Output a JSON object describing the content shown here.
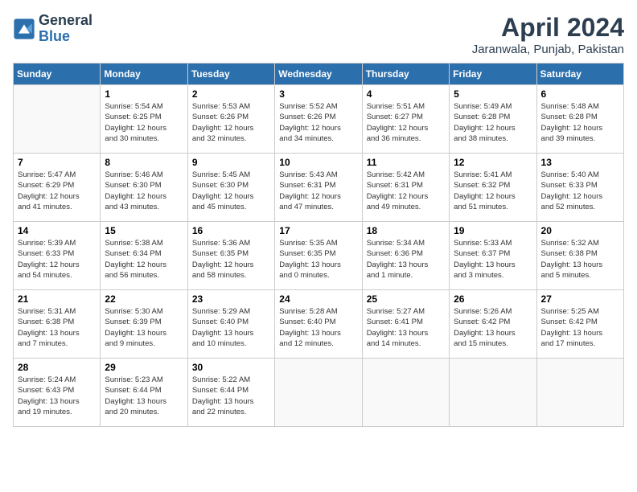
{
  "header": {
    "logo_line1": "General",
    "logo_line2": "Blue",
    "title": "April 2024",
    "subtitle": "Jaranwala, Punjab, Pakistan"
  },
  "calendar": {
    "days_of_week": [
      "Sunday",
      "Monday",
      "Tuesday",
      "Wednesday",
      "Thursday",
      "Friday",
      "Saturday"
    ],
    "weeks": [
      [
        {
          "day": "",
          "info": ""
        },
        {
          "day": "1",
          "info": "Sunrise: 5:54 AM\nSunset: 6:25 PM\nDaylight: 12 hours\nand 30 minutes."
        },
        {
          "day": "2",
          "info": "Sunrise: 5:53 AM\nSunset: 6:26 PM\nDaylight: 12 hours\nand 32 minutes."
        },
        {
          "day": "3",
          "info": "Sunrise: 5:52 AM\nSunset: 6:26 PM\nDaylight: 12 hours\nand 34 minutes."
        },
        {
          "day": "4",
          "info": "Sunrise: 5:51 AM\nSunset: 6:27 PM\nDaylight: 12 hours\nand 36 minutes."
        },
        {
          "day": "5",
          "info": "Sunrise: 5:49 AM\nSunset: 6:28 PM\nDaylight: 12 hours\nand 38 minutes."
        },
        {
          "day": "6",
          "info": "Sunrise: 5:48 AM\nSunset: 6:28 PM\nDaylight: 12 hours\nand 39 minutes."
        }
      ],
      [
        {
          "day": "7",
          "info": "Sunrise: 5:47 AM\nSunset: 6:29 PM\nDaylight: 12 hours\nand 41 minutes."
        },
        {
          "day": "8",
          "info": "Sunrise: 5:46 AM\nSunset: 6:30 PM\nDaylight: 12 hours\nand 43 minutes."
        },
        {
          "day": "9",
          "info": "Sunrise: 5:45 AM\nSunset: 6:30 PM\nDaylight: 12 hours\nand 45 minutes."
        },
        {
          "day": "10",
          "info": "Sunrise: 5:43 AM\nSunset: 6:31 PM\nDaylight: 12 hours\nand 47 minutes."
        },
        {
          "day": "11",
          "info": "Sunrise: 5:42 AM\nSunset: 6:31 PM\nDaylight: 12 hours\nand 49 minutes."
        },
        {
          "day": "12",
          "info": "Sunrise: 5:41 AM\nSunset: 6:32 PM\nDaylight: 12 hours\nand 51 minutes."
        },
        {
          "day": "13",
          "info": "Sunrise: 5:40 AM\nSunset: 6:33 PM\nDaylight: 12 hours\nand 52 minutes."
        }
      ],
      [
        {
          "day": "14",
          "info": "Sunrise: 5:39 AM\nSunset: 6:33 PM\nDaylight: 12 hours\nand 54 minutes."
        },
        {
          "day": "15",
          "info": "Sunrise: 5:38 AM\nSunset: 6:34 PM\nDaylight: 12 hours\nand 56 minutes."
        },
        {
          "day": "16",
          "info": "Sunrise: 5:36 AM\nSunset: 6:35 PM\nDaylight: 12 hours\nand 58 minutes."
        },
        {
          "day": "17",
          "info": "Sunrise: 5:35 AM\nSunset: 6:35 PM\nDaylight: 13 hours\nand 0 minutes."
        },
        {
          "day": "18",
          "info": "Sunrise: 5:34 AM\nSunset: 6:36 PM\nDaylight: 13 hours\nand 1 minute."
        },
        {
          "day": "19",
          "info": "Sunrise: 5:33 AM\nSunset: 6:37 PM\nDaylight: 13 hours\nand 3 minutes."
        },
        {
          "day": "20",
          "info": "Sunrise: 5:32 AM\nSunset: 6:38 PM\nDaylight: 13 hours\nand 5 minutes."
        }
      ],
      [
        {
          "day": "21",
          "info": "Sunrise: 5:31 AM\nSunset: 6:38 PM\nDaylight: 13 hours\nand 7 minutes."
        },
        {
          "day": "22",
          "info": "Sunrise: 5:30 AM\nSunset: 6:39 PM\nDaylight: 13 hours\nand 9 minutes."
        },
        {
          "day": "23",
          "info": "Sunrise: 5:29 AM\nSunset: 6:40 PM\nDaylight: 13 hours\nand 10 minutes."
        },
        {
          "day": "24",
          "info": "Sunrise: 5:28 AM\nSunset: 6:40 PM\nDaylight: 13 hours\nand 12 minutes."
        },
        {
          "day": "25",
          "info": "Sunrise: 5:27 AM\nSunset: 6:41 PM\nDaylight: 13 hours\nand 14 minutes."
        },
        {
          "day": "26",
          "info": "Sunrise: 5:26 AM\nSunset: 6:42 PM\nDaylight: 13 hours\nand 15 minutes."
        },
        {
          "day": "27",
          "info": "Sunrise: 5:25 AM\nSunset: 6:42 PM\nDaylight: 13 hours\nand 17 minutes."
        }
      ],
      [
        {
          "day": "28",
          "info": "Sunrise: 5:24 AM\nSunset: 6:43 PM\nDaylight: 13 hours\nand 19 minutes."
        },
        {
          "day": "29",
          "info": "Sunrise: 5:23 AM\nSunset: 6:44 PM\nDaylight: 13 hours\nand 20 minutes."
        },
        {
          "day": "30",
          "info": "Sunrise: 5:22 AM\nSunset: 6:44 PM\nDaylight: 13 hours\nand 22 minutes."
        },
        {
          "day": "",
          "info": ""
        },
        {
          "day": "",
          "info": ""
        },
        {
          "day": "",
          "info": ""
        },
        {
          "day": "",
          "info": ""
        }
      ]
    ]
  }
}
